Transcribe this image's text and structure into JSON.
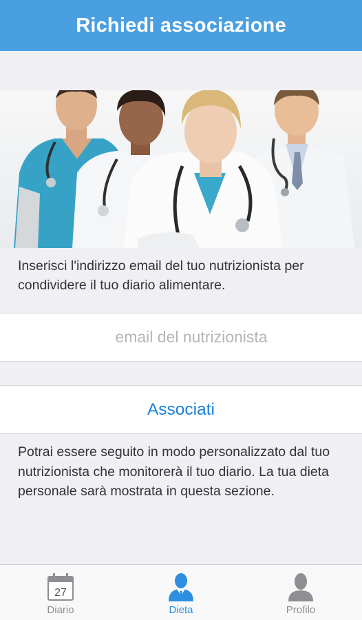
{
  "navbar": {
    "title": "Richiedi associazione"
  },
  "intro": {
    "text": "Inserisci l'indirizzo email del tuo nutrizionista per condividere il tuo diario alimentare."
  },
  "email": {
    "placeholder": "email del nutrizionista",
    "value": ""
  },
  "associate": {
    "label": "Associati"
  },
  "footer": {
    "text": "Potrai essere seguito in modo personalizzato dal tuo nutrizionista che monitorerà il tuo diario. La tua dieta personale sarà mostrata in questa sezione."
  },
  "tabbar": {
    "accent": "#2e8fe0",
    "inactive": "#8e8e93",
    "tabs": [
      {
        "label": "Diario",
        "icon": "calendar-icon",
        "day": "27",
        "active": false
      },
      {
        "label": "Dieta",
        "icon": "doctor-icon",
        "active": true
      },
      {
        "label": "Profilo",
        "icon": "user-icon",
        "active": false
      }
    ]
  },
  "colors": {
    "navbar": "#4a9fe0",
    "link": "#1a80dc",
    "background": "#efeff4"
  }
}
